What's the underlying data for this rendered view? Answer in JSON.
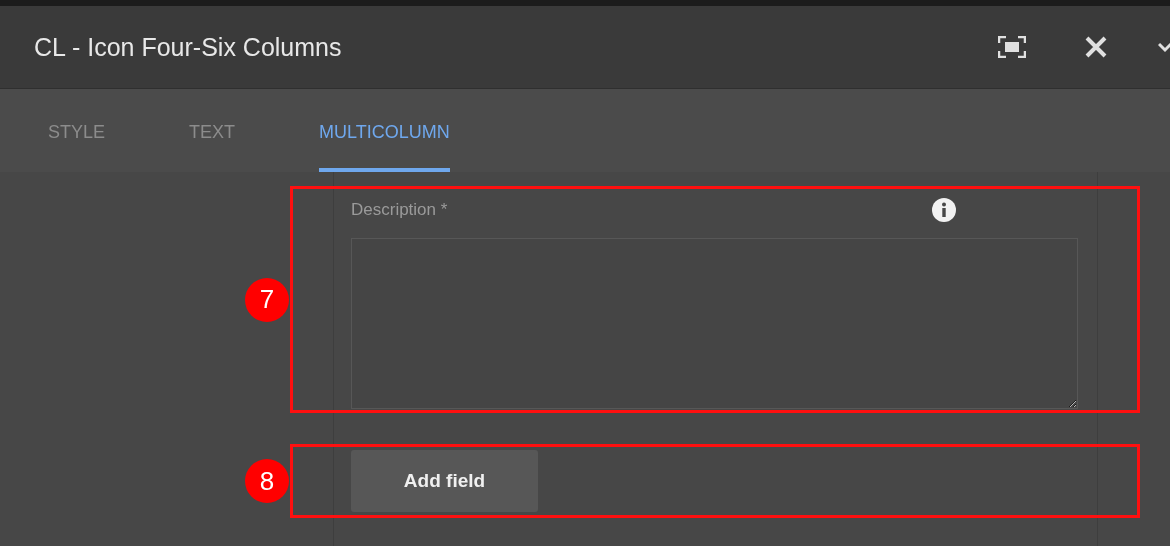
{
  "window": {
    "title": "CL - Icon Four-Six Columns"
  },
  "tabs": [
    {
      "label": "STYLE",
      "selected": false
    },
    {
      "label": "TEXT",
      "selected": false
    },
    {
      "label": "MULTICOLUMN",
      "selected": true
    }
  ],
  "description": {
    "label": "Description *"
  },
  "add_button": {
    "label": "Add field"
  },
  "annotations": [
    {
      "number": "7"
    },
    {
      "number": "8"
    }
  ]
}
